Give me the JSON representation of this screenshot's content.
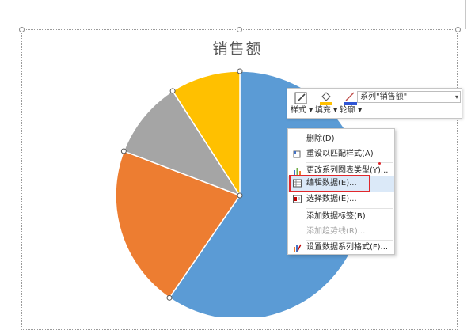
{
  "chart": {
    "title": "销售额"
  },
  "chart_data": {
    "type": "pie",
    "title": "销售额",
    "start_angle_deg": 0,
    "direction": "clockwise",
    "slices": [
      {
        "value": 59,
        "color": "#5b9bd5"
      },
      {
        "value": 21,
        "color": "#ed7d31"
      },
      {
        "value": 10,
        "color": "#a5a5a5"
      },
      {
        "value": 9,
        "color": "#ffc000"
      }
    ]
  },
  "mini_toolbar": {
    "style_label": "样式",
    "fill_label": "填充",
    "outline_label": "轮廓",
    "series_selected": "系列\"销售额\""
  },
  "context_menu": {
    "items": [
      {
        "label": "删除(D)",
        "icon": "none",
        "enabled": true
      },
      {
        "label": "重设以匹配样式(A)",
        "icon": "reset-style-icon",
        "enabled": true
      },
      {
        "label": "更改系列图表类型(Y)...",
        "icon": "bar-chart-icon",
        "enabled": true
      },
      {
        "label": "编辑数据(E)...",
        "icon": "table-edit-icon",
        "enabled": true,
        "hovered": true
      },
      {
        "label": "选择数据(E)...",
        "icon": "select-data-icon",
        "enabled": true
      },
      {
        "label": "添加数据标签(B)",
        "icon": "none",
        "enabled": true
      },
      {
        "label": "添加趋势线(R)...",
        "icon": "none",
        "enabled": false
      },
      {
        "label": "设置数据系列格式(F)...",
        "icon": "format-series-icon",
        "enabled": true
      }
    ]
  },
  "colors": {
    "accent_highlight": "#e0282c",
    "menu_hover": "#dbe9f8"
  }
}
